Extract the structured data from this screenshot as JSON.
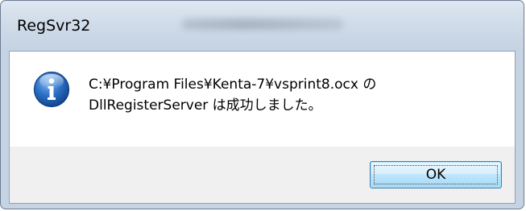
{
  "window": {
    "title": "RegSvr32"
  },
  "dialog": {
    "icon": "info-icon",
    "message_line1": "C:¥Program Files¥Kenta-7¥vsprint8.ocx の",
    "message_line2": "DllRegisterServer は成功しました。"
  },
  "buttons": {
    "ok_label": "OK"
  },
  "colors": {
    "frame": "#c5d3e3",
    "button_border": "#3c7fb1",
    "icon_blue": "#1f5fae"
  }
}
